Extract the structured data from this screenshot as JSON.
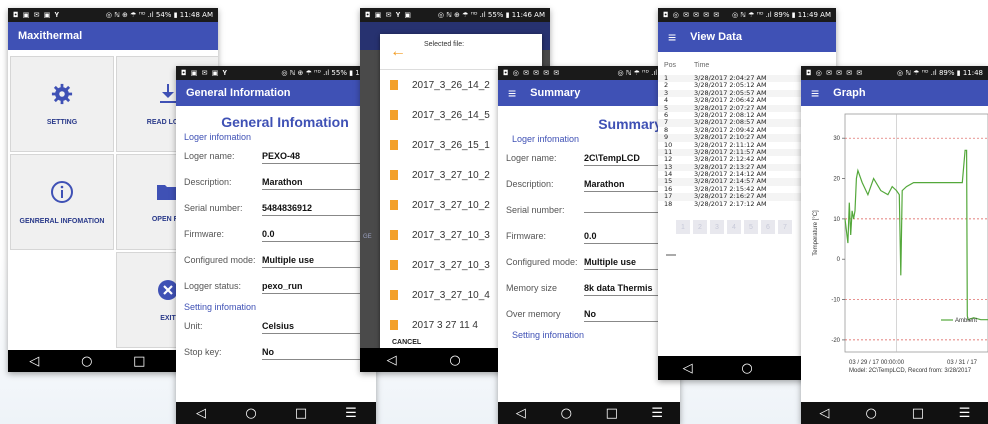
{
  "colors": {
    "primary": "#3f51b5",
    "accent_orange": "#f29a1e",
    "series_green": "#54a83b",
    "threshold_red": "#d9534f"
  },
  "phone1": {
    "status": {
      "icons": "◘ ▣ ✉ ▣ 𝐘",
      "right": "◎ ℕ ⊕ ☂ ᴴᴰ .ıl 54% ▮ 11:48 AM"
    },
    "title": "Maxithermal",
    "tiles": {
      "setting": {
        "label": "SETTING",
        "icon": "gear-icon"
      },
      "read_log": {
        "label": "READ LOGG",
        "icon": "download-icon"
      },
      "general": {
        "label": "GENRERAL INFOMATION",
        "icon": "info-icon"
      },
      "open_file": {
        "label": "OPEN FIL",
        "icon": "folder-icon"
      },
      "exit": {
        "label": "EXIT",
        "icon": "close-icon"
      }
    }
  },
  "phone2": {
    "status": {
      "icons": "◘ ▣ ✉ ▣ 𝐘",
      "right": "◎ ℕ ⊕ ☂ ᴴᴰ .ıl 55% ▮ 11:4"
    },
    "title": "General Information",
    "heading": "General Infomation",
    "section_logger": "Loger infomation",
    "rows": [
      {
        "key": "Loger name:",
        "value": "PEXO-48"
      },
      {
        "key": "Description:",
        "value": "Marathon"
      },
      {
        "key": "Serial number:",
        "value": "5484836912"
      },
      {
        "key": "Firmware:",
        "value": "0.0"
      },
      {
        "key": "Configured mode:",
        "value": "Multiple use"
      },
      {
        "key": "Logger status:",
        "value": "pexo_run"
      }
    ],
    "section_setting": "Setting infomation",
    "rows2": [
      {
        "key": "Unit:",
        "value": "Celsius"
      },
      {
        "key": "Stop key:",
        "value": "No"
      }
    ]
  },
  "phone3": {
    "status": {
      "icons": "◘ ▣ ✉ 𝐘 ▣",
      "right": "◎ ℕ ⊕ ☂ ᴴᴰ .ıl 55% ▮ 11:46 AM"
    },
    "dialog_title": "Selected file:",
    "files": [
      "2017_3_26_14_2",
      "2017_3_26_14_5",
      "2017_3_26_15_1",
      "2017_3_27_10_2",
      "2017_3_27_10_2",
      "2017_3_27_10_3",
      "2017_3_27_10_3",
      "2017_3_27_10_4",
      "2017 3 27 11 4"
    ],
    "cancel": "CANCEL",
    "behind_label": "GE"
  },
  "phone4": {
    "status": {
      "icons": "◘ ◎ ✉ ✉ ✉ ✉",
      "right": "◎ ℕ ☂ ᴴᴰ .ıl 89%"
    },
    "title": "Summary",
    "heading": "Summary",
    "section_logger": "Loger infomation",
    "rows": [
      {
        "key": "Loger name:",
        "value": "2C\\TempLCD"
      },
      {
        "key": "Description:",
        "value": "Marathon"
      },
      {
        "key": "Serial number:",
        "value": ""
      },
      {
        "key": "Firmware:",
        "value": "0.0"
      },
      {
        "key": "Configured mode:",
        "value": "Multiple use"
      },
      {
        "key": "Memory size",
        "value": "8k data Thermis"
      },
      {
        "key": "Over memory",
        "value": "No"
      }
    ],
    "section_setting": "Setting infomation"
  },
  "phone5": {
    "status": {
      "icons": "◘ ◎ ✉ ✉ ✉ ✉",
      "right": "◎ ℕ ☂ ᴴᴰ .ıl 89% ▮ 11:49 AM"
    },
    "title": "View Data",
    "col_pos": "Pos",
    "col_time": "Time",
    "rows": [
      {
        "pos": "1",
        "time": "3/28/2017 2:04:27 AM"
      },
      {
        "pos": "2",
        "time": "3/28/2017 2:05:12 AM"
      },
      {
        "pos": "3",
        "time": "3/28/2017 2:05:57 AM"
      },
      {
        "pos": "4",
        "time": "3/28/2017 2:06:42 AM"
      },
      {
        "pos": "5",
        "time": "3/28/2017 2:07:27 AM"
      },
      {
        "pos": "6",
        "time": "3/28/2017 2:08:12 AM"
      },
      {
        "pos": "7",
        "time": "3/28/2017 2:08:57 AM"
      },
      {
        "pos": "8",
        "time": "3/28/2017 2:09:42 AM"
      },
      {
        "pos": "9",
        "time": "3/28/2017 2:10:27 AM"
      },
      {
        "pos": "10",
        "time": "3/28/2017 2:11:12 AM"
      },
      {
        "pos": "11",
        "time": "3/28/2017 2:11:57 AM"
      },
      {
        "pos": "12",
        "time": "3/28/2017 2:12:42 AM"
      },
      {
        "pos": "13",
        "time": "3/28/2017 2:13:27 AM"
      },
      {
        "pos": "14",
        "time": "3/28/2017 2:14:12 AM"
      },
      {
        "pos": "15",
        "time": "3/28/2017 2:14:57 AM"
      },
      {
        "pos": "16",
        "time": "3/28/2017 2:15:42 AM"
      },
      {
        "pos": "17",
        "time": "3/28/2017 2:16:27 AM"
      },
      {
        "pos": "18",
        "time": "3/28/2017 2:17:12 AM"
      }
    ],
    "pages": [
      "1",
      "2",
      "3",
      "4",
      "5",
      "6",
      "7"
    ]
  },
  "phone6": {
    "status": {
      "icons": "◘ ◎ ✉ ✉ ✉ ✉",
      "right": "◎ ℕ ☂ ᴴᴰ .ıl 89% ▮ 11:48"
    },
    "title": "Graph",
    "x_tick_1": "03 / 29 / 17 00:00:00",
    "x_tick_2": "03 / 31 / 17",
    "footer": "Model: 2C\\TempLCD, Record from: 3/28/2017"
  },
  "chart_data": {
    "type": "line",
    "ylabel": "Temperature [°C]",
    "yticks": [
      30,
      20,
      10,
      0,
      -10,
      -20
    ],
    "ylim": [
      -23,
      36
    ],
    "xlim": [
      0,
      100
    ],
    "thresholds": [
      30,
      10,
      -10,
      -20
    ],
    "grid": true,
    "legend_position": "bottom-right",
    "series": [
      {
        "name": "Ambient",
        "color": "#54a83b",
        "x": [
          0,
          2,
          3,
          4,
          5,
          6,
          7,
          8,
          9,
          12,
          16,
          20,
          25,
          30,
          33,
          36,
          38,
          39,
          40,
          43,
          48,
          54,
          60,
          66,
          72,
          78,
          82,
          84,
          84.5,
          85,
          85.5,
          86,
          90,
          95,
          100
        ],
        "y": [
          10,
          4,
          14,
          6,
          12,
          10,
          12,
          20,
          22,
          19,
          16,
          20,
          17,
          16,
          18,
          17,
          16,
          -4,
          17,
          18,
          19,
          19,
          19,
          19,
          19,
          19,
          19,
          27,
          27,
          27,
          -14,
          -15,
          -14.5,
          -15,
          -15
        ]
      }
    ]
  }
}
